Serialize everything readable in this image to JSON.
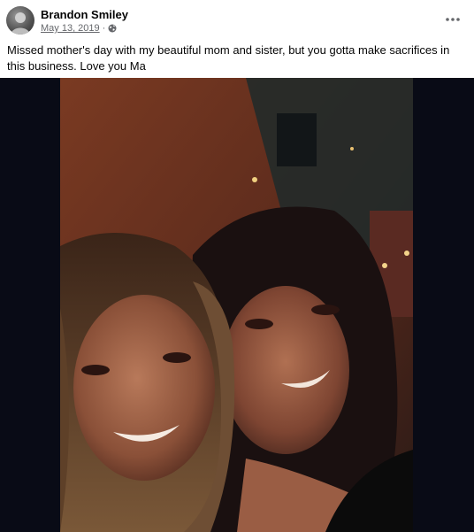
{
  "post": {
    "author": "Brandon Smiley",
    "date": "May 13, 2019",
    "separator": "·",
    "privacy_icon": "globe-icon",
    "more_icon": "more-options-icon",
    "caption": "Missed mother's day with my beautiful mom and sister, but you gotta make sacrifices in this business. Love you Ma"
  },
  "colors": {
    "author_text": "#050505",
    "meta_text": "#65676b",
    "photo_letterbox": "#090b16"
  }
}
